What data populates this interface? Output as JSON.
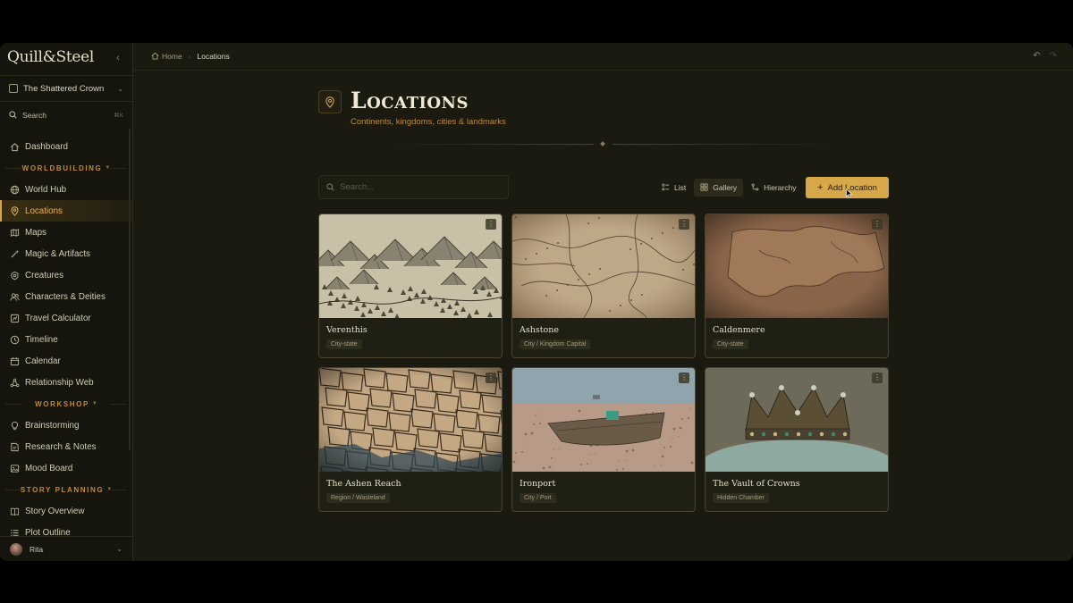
{
  "sidebar": {
    "brand": "Quill&Steel",
    "project": "The Shattered Crown",
    "search_label": "Search",
    "search_shortcut": "⌘K",
    "items": [
      {
        "type": "item",
        "label": "Dashboard",
        "icon": "home-icon"
      },
      {
        "type": "section",
        "label": "WORLDBUILDING"
      },
      {
        "type": "item",
        "label": "World Hub",
        "icon": "globe-icon"
      },
      {
        "type": "item",
        "label": "Locations",
        "icon": "map-pin-icon",
        "active": true
      },
      {
        "type": "item",
        "label": "Maps",
        "icon": "map-icon"
      },
      {
        "type": "item",
        "label": "Magic & Artifacts",
        "icon": "wand-icon"
      },
      {
        "type": "item",
        "label": "Creatures",
        "icon": "paw-icon"
      },
      {
        "type": "item",
        "label": "Characters & Deities",
        "icon": "users-icon"
      },
      {
        "type": "item",
        "label": "Travel Calculator",
        "icon": "route-icon"
      },
      {
        "type": "item",
        "label": "Timeline",
        "icon": "clock-icon"
      },
      {
        "type": "item",
        "label": "Calendar",
        "icon": "calendar-icon"
      },
      {
        "type": "item",
        "label": "Relationship Web",
        "icon": "network-icon"
      },
      {
        "type": "section",
        "label": "WORKSHOP"
      },
      {
        "type": "item",
        "label": "Brainstorming",
        "icon": "lightbulb-icon"
      },
      {
        "type": "item",
        "label": "Research & Notes",
        "icon": "notes-icon"
      },
      {
        "type": "item",
        "label": "Mood Board",
        "icon": "image-icon"
      },
      {
        "type": "section",
        "label": "STORY PLANNING"
      },
      {
        "type": "item",
        "label": "Story Overview",
        "icon": "book-icon"
      },
      {
        "type": "item",
        "label": "Plot Outline",
        "icon": "list-icon"
      }
    ],
    "user": "Rita"
  },
  "breadcrumb": {
    "home": "Home",
    "current": "Locations"
  },
  "page": {
    "title": "Locations",
    "subtitle": "Continents, kingdoms, cities & landmarks"
  },
  "toolbar": {
    "search_placeholder": "Search...",
    "views": [
      {
        "label": "List",
        "icon": "list-icon"
      },
      {
        "label": "Gallery",
        "icon": "grid-icon",
        "active": true
      },
      {
        "label": "Hierarchy",
        "icon": "hierarchy-icon"
      }
    ],
    "add_label": "Add Location"
  },
  "locations": [
    {
      "name": "Verenthis",
      "type": "City-state",
      "image": "mountain-map"
    },
    {
      "name": "Ashstone",
      "type": "City / Kingdom Capital",
      "image": "parchment-map"
    },
    {
      "name": "Caldenmere",
      "type": "City-state",
      "image": "old-world-map"
    },
    {
      "name": "The Ashen Reach",
      "type": "Region / Wasteland",
      "image": "cracked-earth"
    },
    {
      "name": "Ironport",
      "type": "City / Port",
      "image": "beached-boat"
    },
    {
      "name": "The Vault of Crowns",
      "type": "Hidden Chamber",
      "image": "jeweled-crown"
    }
  ],
  "colors": {
    "accent": "#d7a84a",
    "background": "#1a1a10",
    "sidebar": "#15150d",
    "section_header": "#c08a3a"
  }
}
